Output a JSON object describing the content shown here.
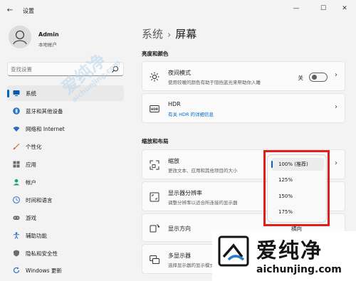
{
  "window": {
    "title": "设置",
    "back_icon": "back-arrow-icon",
    "minimize_icon": "minimize-icon",
    "maximize_icon": "maximize-icon",
    "close_icon": "close-icon"
  },
  "profile": {
    "name": "Admin",
    "subtitle": "本地帐户",
    "avatar_icon": "user-avatar-icon"
  },
  "search": {
    "placeholder": "查找设置",
    "icon": "search-icon"
  },
  "sidebar": {
    "accent": "#0067c0",
    "items": [
      {
        "label": "系统",
        "icon": "system-icon",
        "active": true
      },
      {
        "label": "蓝牙和其他设备",
        "icon": "bluetooth-icon"
      },
      {
        "label": "网络和 Internet",
        "icon": "wifi-icon"
      },
      {
        "label": "个性化",
        "icon": "brush-icon"
      },
      {
        "label": "应用",
        "icon": "apps-icon"
      },
      {
        "label": "帐户",
        "icon": "account-icon"
      },
      {
        "label": "时间和语言",
        "icon": "globe-clock-icon"
      },
      {
        "label": "游戏",
        "icon": "gamepad-icon"
      },
      {
        "label": "辅助功能",
        "icon": "accessibility-icon"
      },
      {
        "label": "隐私和安全性",
        "icon": "shield-icon"
      },
      {
        "label": "Windows 更新",
        "icon": "update-icon"
      }
    ]
  },
  "breadcrumb": {
    "parent": "系统",
    "separator": "›",
    "current": "屏幕"
  },
  "sections": {
    "brightness": {
      "title": "亮度和颜色",
      "night_light": {
        "title": "夜间模式",
        "desc": "使用较暖的颜色有助于阻挡蓝光来帮助你入睡",
        "toggle_label": "关",
        "toggle_on": false,
        "icon": "brightness-icon"
      },
      "hdr": {
        "title": "HDR",
        "desc": "有关 HDR 的详细信息",
        "icon": "hdr-icon"
      }
    },
    "scale_layout": {
      "title": "缩放和布局",
      "scale": {
        "title": "缩放",
        "desc": "更改文本、应用和其他项目的大小",
        "icon": "scale-icon"
      },
      "resolution": {
        "title": "显示器分辨率",
        "desc": "调整分辨率以适合所连接的显示器",
        "icon": "resolution-icon"
      },
      "orientation": {
        "title": "显示方向",
        "value": "横向",
        "icon": "orientation-icon"
      },
      "multi_display": {
        "title": "多显示器",
        "desc": "选择显示器的显示模式",
        "icon": "multi-display-icon"
      }
    }
  },
  "scale_dropdown": {
    "options": [
      "100% (推荐)",
      "125%",
      "150%",
      "175%"
    ],
    "selected": "100% (推荐)",
    "highlight_color": "#e01e1e"
  },
  "watermark": {
    "overlay_cn": "爱纯净",
    "overlay_url": "aichunjing.com",
    "brand_cn": "爱纯净",
    "brand_url": "aichunjing.com",
    "color": "#2b7cc8"
  }
}
